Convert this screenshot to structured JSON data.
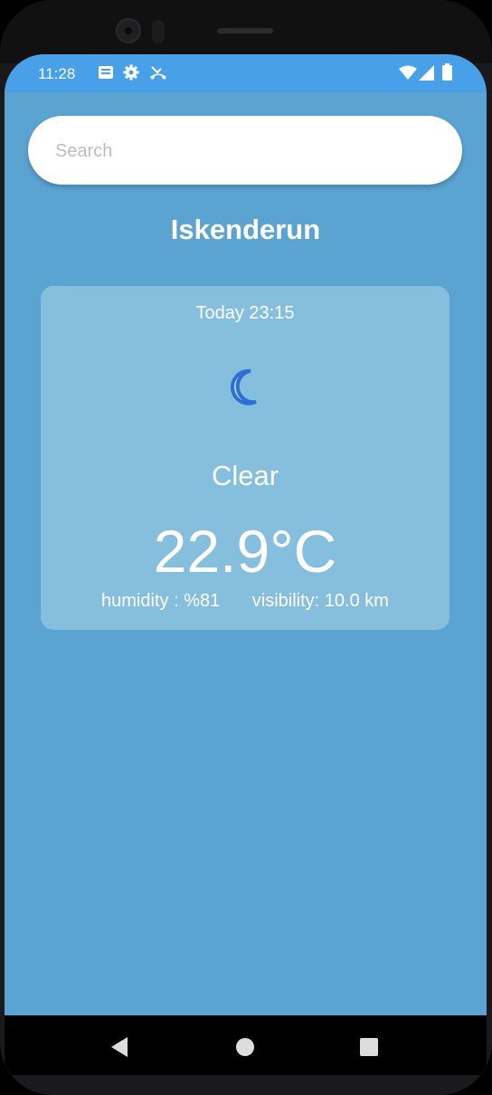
{
  "status_bar": {
    "time": "11:28",
    "left_icons": [
      "notes-icon",
      "gear-icon",
      "phone-missed-icon"
    ],
    "right_icons": [
      "wifi-icon",
      "signal-icon",
      "battery-icon"
    ]
  },
  "search": {
    "placeholder": "Search",
    "value": ""
  },
  "city": "Iskenderun",
  "weather": {
    "datetime": "Today 23:15",
    "icon": "moon-icon",
    "condition": "Clear",
    "temperature": "22.9°C",
    "humidity": "humidity : %81",
    "visibility": "visibility: 10.0 km"
  },
  "nav_bar": {
    "buttons": [
      "back-icon",
      "home-icon",
      "recents-icon"
    ]
  },
  "colors": {
    "background": "#5ba4d2",
    "status_bar": "#47a0e8",
    "card": "#86bede",
    "moon": "#2e6fd6"
  }
}
